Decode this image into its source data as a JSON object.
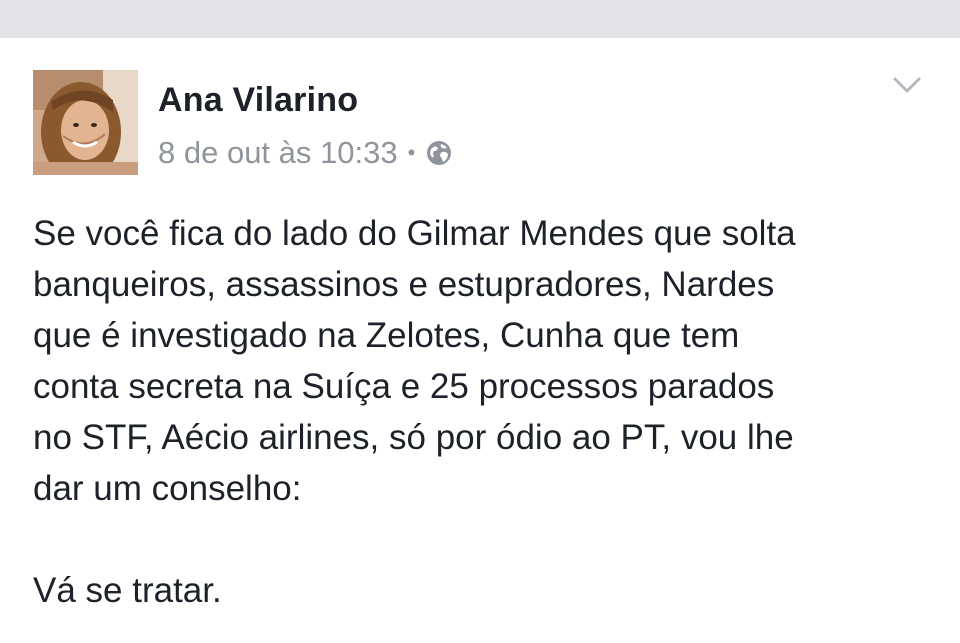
{
  "post": {
    "author": "Ana Vilarino",
    "timestamp": "8 de out às 10:33",
    "separator": "•",
    "audience_icon": "globe-icon",
    "options_icon": "chevron-down-icon",
    "paragraphs": [
      "Se você fica do lado do Gilmar Mendes que solta\nbanqueiros, assassinos e estupradores, Nardes\nque é investigado na Zelotes, Cunha que tem\nconta secreta na Suíça e 25 processos parados\nno STF, Aécio airlines, só por ódio ao PT, vou lhe\ndar um conselho:",
      "Vá se tratar."
    ]
  },
  "colors": {
    "top_band": "#e1e3e7",
    "name_text": "#1d2129",
    "meta_text": "#90949c",
    "body_text": "#1d2129"
  }
}
